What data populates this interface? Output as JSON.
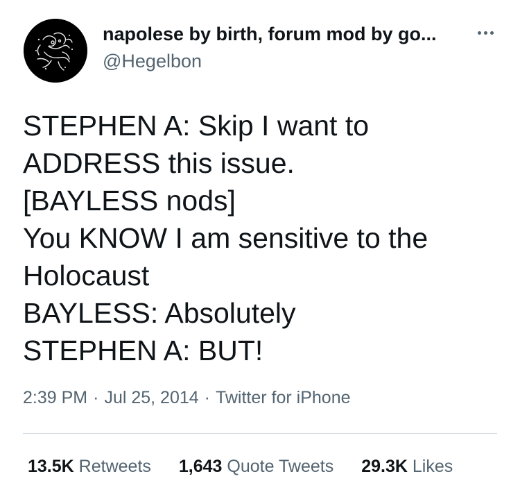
{
  "author": {
    "display_name": "napolese by birth, forum mod by go...",
    "handle": "@Hegelbon",
    "avatar_icon": "avatar-sketch-icon"
  },
  "more_icon": "more-options-icon",
  "tweet_text": "STEPHEN A: Skip I want to\nADDRESS this issue.\n[BAYLESS nods]\nYou KNOW I am sensitive to the\nHolocaust\nBAYLESS: Absolutely\nSTEPHEN A: BUT!",
  "meta": {
    "time": "2:39 PM",
    "date": "Jul 25, 2014",
    "separator": "·",
    "source": "Twitter for iPhone"
  },
  "stats": {
    "retweets_count": "13.5K",
    "retweets_label": "Retweets",
    "quotes_count": "1,643",
    "quotes_label": "Quote Tweets",
    "likes_count": "29.3K",
    "likes_label": "Likes"
  },
  "colors": {
    "text": "#0f1419",
    "secondary": "#536471",
    "divider": "#cfd9de",
    "background": "#ffffff"
  }
}
